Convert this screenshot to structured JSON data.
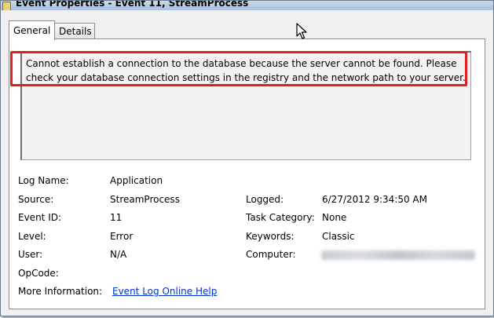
{
  "window": {
    "title": "Event Properties - Event 11, StreamProcess"
  },
  "tabs": [
    {
      "label": "General",
      "active": true
    },
    {
      "label": "Details",
      "active": false
    }
  ],
  "description": "Cannot establish a connection to the database because the server cannot be found. Please check your database connection settings in the registry and the network path to your server.",
  "fields": {
    "log_name": {
      "label": "Log Name:",
      "value": "Application"
    },
    "source": {
      "label": "Source:",
      "value": "StreamProcess"
    },
    "event_id": {
      "label": "Event ID:",
      "value": "11"
    },
    "level": {
      "label": "Level:",
      "value": "Error"
    },
    "user": {
      "label": "User:",
      "value": "N/A"
    },
    "opcode": {
      "label": "OpCode:",
      "value": ""
    },
    "more_info": {
      "label": "More Information:",
      "value": "Event Log Online Help"
    },
    "logged": {
      "label": "Logged:",
      "value": "6/27/2012 9:34:50 AM"
    },
    "task_category": {
      "label": "Task Category:",
      "value": "None"
    },
    "keywords": {
      "label": "Keywords:",
      "value": "Classic"
    },
    "computer": {
      "label": "Computer:"
    }
  },
  "colors": {
    "highlight": "#e02020",
    "link": "#0033cc"
  }
}
